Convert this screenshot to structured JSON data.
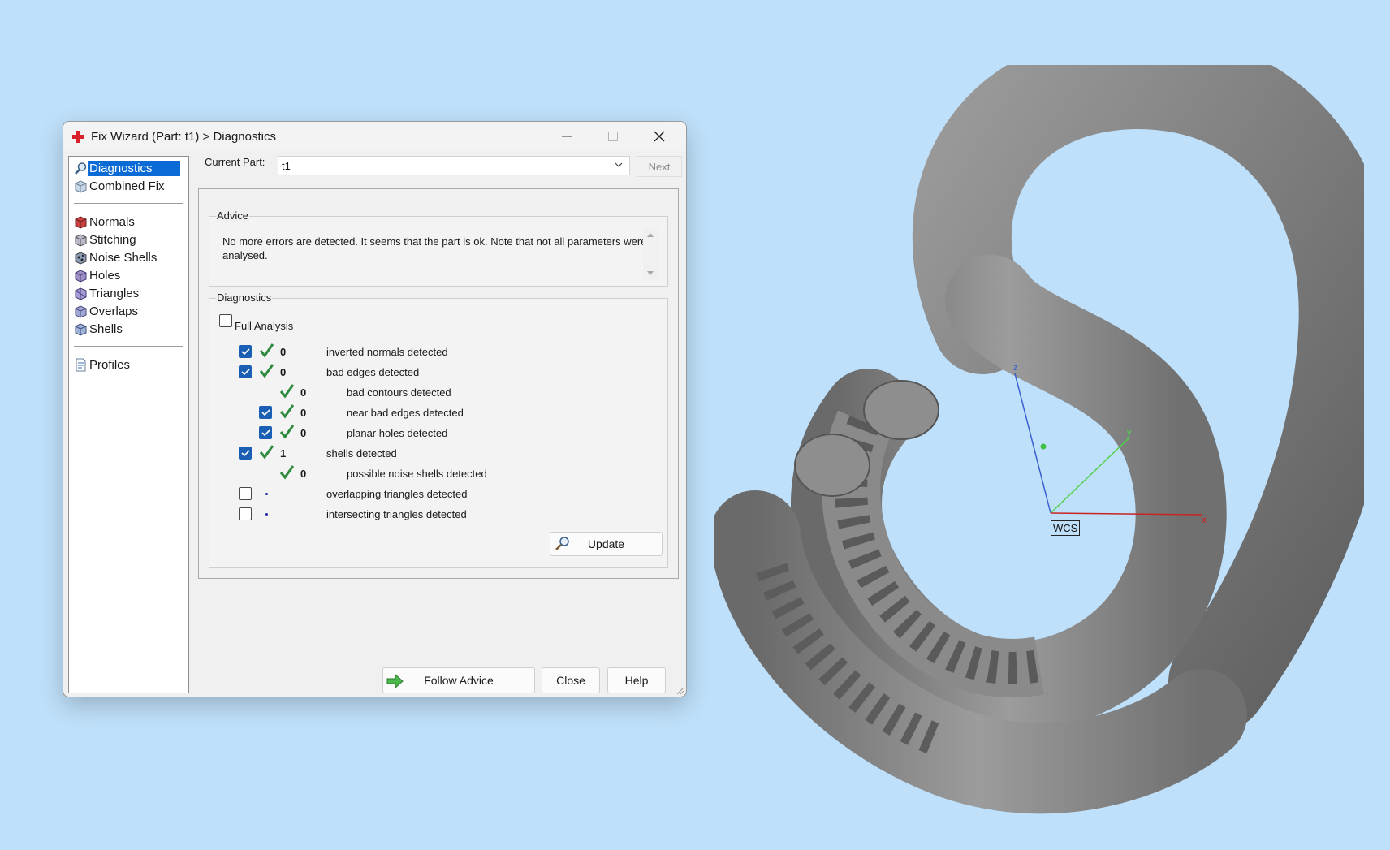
{
  "window": {
    "title": "Fix Wizard (Part: t1) > Diagnostics"
  },
  "nav": {
    "items": [
      {
        "label": "Diagnostics",
        "icon": "magnifier-icon",
        "selected": true
      },
      {
        "label": "Combined Fix",
        "icon": "cube-icon"
      },
      {
        "label": "Normals",
        "icon": "red-cube-icon"
      },
      {
        "label": "Stitching",
        "icon": "stitching-cube-icon"
      },
      {
        "label": "Noise Shells",
        "icon": "noise-shells-icon"
      },
      {
        "label": "Holes",
        "icon": "holes-cube-icon"
      },
      {
        "label": "Triangles",
        "icon": "triangles-cube-icon"
      },
      {
        "label": "Overlaps",
        "icon": "overlaps-cube-icon"
      },
      {
        "label": "Shells",
        "icon": "shells-cube-icon"
      },
      {
        "label": "Profiles",
        "icon": "document-icon"
      }
    ]
  },
  "part": {
    "label": "Current Part:",
    "value": "t1",
    "next_label": "Next"
  },
  "advice": {
    "title": "Advice",
    "text": "No more errors are detected. It seems that the part is ok. Note that not all parameters were analysed."
  },
  "diagnostics": {
    "title": "Diagnostics",
    "full_analysis_label": "Full Analysis",
    "rows": [
      {
        "count": "0",
        "label": "inverted normals detected"
      },
      {
        "count": "0",
        "label": "bad edges detected"
      },
      {
        "count": "0",
        "label": "bad contours detected"
      },
      {
        "count": "0",
        "label": "near bad edges detected"
      },
      {
        "count": "0",
        "label": "planar holes detected"
      },
      {
        "count": "1",
        "label": "shells detected"
      },
      {
        "count": "0",
        "label": "possible noise shells detected"
      },
      {
        "count": "",
        "label": "overlapping triangles detected"
      },
      {
        "count": "",
        "label": "intersecting triangles detected"
      }
    ],
    "update_label": "Update"
  },
  "buttons": {
    "follow_advice": "Follow Advice",
    "close": "Close",
    "help": "Help"
  },
  "viewport": {
    "wcs_label": "WCS",
    "axis_x": "x",
    "axis_y": "y",
    "axis_z": "z"
  },
  "colors": {
    "background": "#bfe0fa",
    "selection": "#0a6ad6",
    "checkbox": "#1a5fb4",
    "tick": "#2e8b3e",
    "model": "#8a8a8a"
  }
}
